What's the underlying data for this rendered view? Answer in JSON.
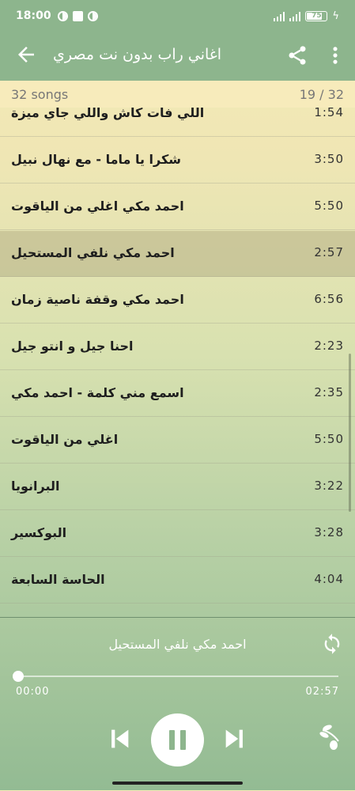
{
  "status": {
    "time": "18:00",
    "battery": "75"
  },
  "appbar": {
    "title": "اغاني راب بدون نت مصري"
  },
  "list_header": {
    "count": "32 songs",
    "position": "19 / 32"
  },
  "songs": [
    {
      "title": "اللي فات كاش واللي جاي ميزة",
      "duration": "1:54"
    },
    {
      "title": "شكرا يا ماما - مع نهال نبيل",
      "duration": "3:50"
    },
    {
      "title": "احمد مكي اغلي من الياقوت",
      "duration": "5:50"
    },
    {
      "title": "احمد مكي نلفي المستحيل",
      "duration": "2:57"
    },
    {
      "title": "احمد مكي وقفة ناصية زمان",
      "duration": "6:56"
    },
    {
      "title": "احنا جيل و انتو جيل",
      "duration": "2:23"
    },
    {
      "title": "اسمع مني كلمة - احمد مكي",
      "duration": "2:35"
    },
    {
      "title": "اغلي من الياقوت",
      "duration": "5:50"
    },
    {
      "title": "البرانويا",
      "duration": "3:22"
    },
    {
      "title": "البوكسير",
      "duration": "3:28"
    },
    {
      "title": "الحاسة السابعة",
      "duration": "4:04"
    }
  ],
  "active_song_index": 3,
  "player": {
    "now_playing": "احمد مكي نلفي المستحيل",
    "elapsed": "00:00",
    "total": "02:57",
    "progress": 0
  },
  "icons": [
    "back-arrow-icon",
    "share-icon",
    "more-vert-icon",
    "repeat-icon",
    "skip-previous-icon",
    "pause-icon",
    "skip-next-icon",
    "olive-branch-icon"
  ],
  "colors": {
    "accent": "#8db58d",
    "header_bg": "#f7ebbb",
    "active_row": "#c4be98"
  }
}
